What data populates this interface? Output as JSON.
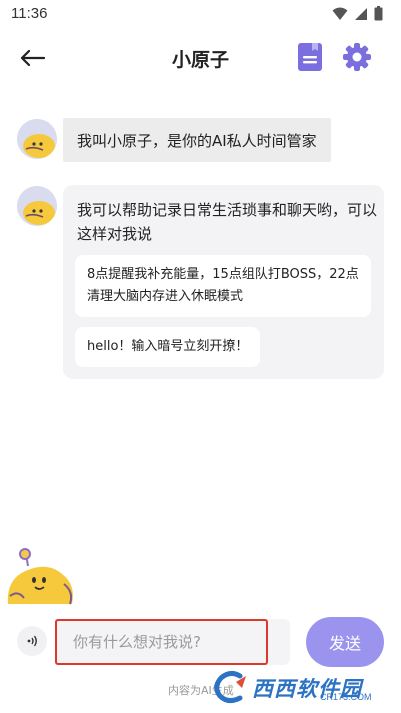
{
  "status_bar": {
    "time": "11:36"
  },
  "header": {
    "title": "小原子"
  },
  "messages": [
    {
      "text": "我叫小原子，是你的AI私人时间管家"
    },
    {
      "text": "我可以帮助记录日常生活琐事和聊天哟，可以这样对我说",
      "suggestions": [
        "8点提醒我补充能量，15点组队打BOSS，22点清理大脑内存进入休眠模式",
        "hello！输入暗号立刻开撩！"
      ]
    }
  ],
  "input": {
    "placeholder": "你有什么想对我说?",
    "value": ""
  },
  "send_label": "发送",
  "disclaimer": "内容为AI生成",
  "watermark": {
    "brand": "西西软件园",
    "url": "CR173.COM"
  },
  "colors": {
    "accent": "#9b94ef",
    "icon_purple": "#7b6fe0",
    "highlight": "#d93a2b"
  },
  "icons": [
    "wifi-icon",
    "signal-icon",
    "battery-icon",
    "back-arrow-icon",
    "note-icon",
    "gear-icon",
    "voice-icon"
  ]
}
